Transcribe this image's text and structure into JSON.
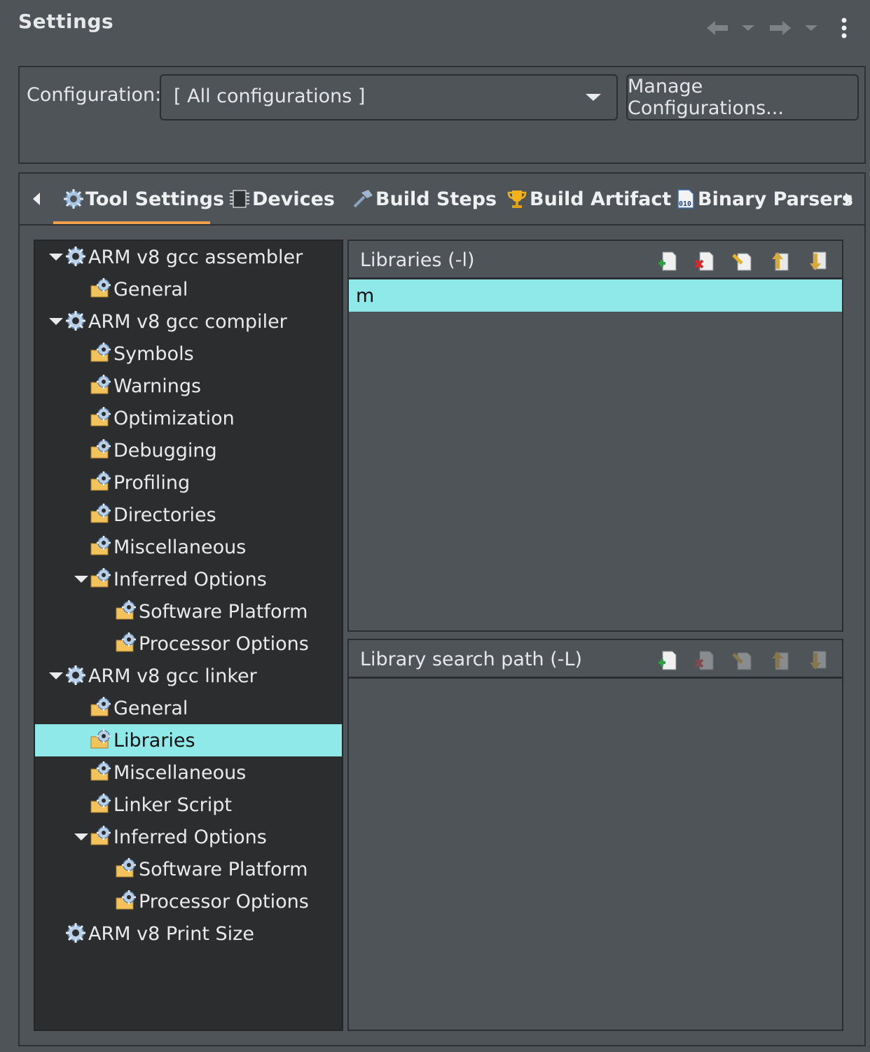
{
  "header": {
    "title": "Settings",
    "nav_icons": [
      "back-arrow-icon",
      "back-dropdown-icon",
      "forward-arrow-icon",
      "forward-dropdown-icon",
      "more-menu-icon"
    ]
  },
  "configuration": {
    "label": "Configuration:",
    "selected": "[ All configurations ]",
    "manage_button": "Manage Configurations..."
  },
  "tabs": [
    {
      "label": "Tool Settings",
      "icon": "gear-icon",
      "active": true
    },
    {
      "label": "Devices",
      "icon": "chip-icon",
      "active": false
    },
    {
      "label": "Build Steps",
      "icon": "hammer-icon",
      "active": false
    },
    {
      "label": "Build Artifact",
      "icon": "trophy-icon",
      "active": false
    },
    {
      "label": "Binary Parsers",
      "icon": "binary-file-icon",
      "active": false
    }
  ],
  "tree": [
    {
      "label": "ARM v8 gcc assembler",
      "level": 0,
      "expanded": true,
      "icon": "tool-gear-icon"
    },
    {
      "label": "General",
      "level": 1,
      "icon": "option-folder-icon"
    },
    {
      "label": "ARM v8 gcc compiler",
      "level": 0,
      "expanded": true,
      "icon": "tool-gear-icon"
    },
    {
      "label": "Symbols",
      "level": 1,
      "icon": "option-folder-icon"
    },
    {
      "label": "Warnings",
      "level": 1,
      "icon": "option-folder-icon"
    },
    {
      "label": "Optimization",
      "level": 1,
      "icon": "option-folder-icon"
    },
    {
      "label": "Debugging",
      "level": 1,
      "icon": "option-folder-icon"
    },
    {
      "label": "Profiling",
      "level": 1,
      "icon": "option-folder-icon"
    },
    {
      "label": "Directories",
      "level": 1,
      "icon": "option-folder-icon"
    },
    {
      "label": "Miscellaneous",
      "level": 1,
      "icon": "option-folder-icon"
    },
    {
      "label": "Inferred Options",
      "level": 1,
      "expanded": true,
      "icon": "option-folder-icon"
    },
    {
      "label": "Software Platform",
      "level": 2,
      "icon": "option-folder-icon"
    },
    {
      "label": "Processor Options",
      "level": 2,
      "icon": "option-folder-icon"
    },
    {
      "label": "ARM v8 gcc linker",
      "level": 0,
      "expanded": true,
      "icon": "tool-gear-icon"
    },
    {
      "label": "General",
      "level": 1,
      "icon": "option-folder-icon"
    },
    {
      "label": "Libraries",
      "level": 1,
      "selected": true,
      "icon": "option-folder-icon"
    },
    {
      "label": "Miscellaneous",
      "level": 1,
      "icon": "option-folder-icon"
    },
    {
      "label": "Linker Script",
      "level": 1,
      "icon": "option-folder-icon"
    },
    {
      "label": "Inferred Options",
      "level": 1,
      "expanded": true,
      "icon": "option-folder-icon"
    },
    {
      "label": "Software Platform",
      "level": 2,
      "icon": "option-folder-icon"
    },
    {
      "label": "Processor Options",
      "level": 2,
      "icon": "option-folder-icon"
    },
    {
      "label": "ARM v8 Print Size",
      "level": 0,
      "icon": "tool-gear-icon"
    }
  ],
  "libraries": {
    "title": "Libraries (-l)",
    "items": [
      "m"
    ],
    "toolbar": [
      "add-icon",
      "delete-icon",
      "edit-icon",
      "move-up-icon",
      "move-down-icon"
    ]
  },
  "library_paths": {
    "title": "Library search path (-L)",
    "items": [],
    "toolbar": [
      "add-icon",
      "delete-icon",
      "edit-icon",
      "move-up-icon",
      "move-down-icon"
    ]
  },
  "colors": {
    "background": "#4f5458",
    "tree_background": "#2b2d2f",
    "selection": "#8fe9e9",
    "tab_accent": "#f0a04a"
  }
}
